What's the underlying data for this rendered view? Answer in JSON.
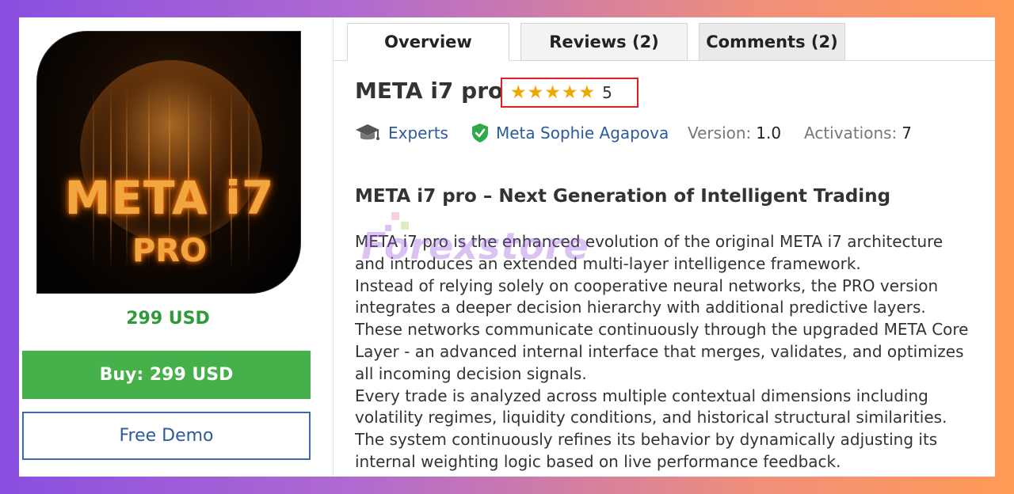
{
  "product": {
    "image_alt": "META i7 PRO logo",
    "logo_text_main": "META i7",
    "logo_text_sub": "PRO",
    "price": "299 USD",
    "buy_label": "Buy: 299 USD",
    "demo_label": "Free Demo",
    "title": "META i7 pro",
    "rating_stars": "★★★★★",
    "rating_value": "5",
    "category": "Experts",
    "author": "Meta Sophie Agapova",
    "version_label": "Version:",
    "version_value": "1.0",
    "activations_label": "Activations:",
    "activations_value": "7"
  },
  "tabs": {
    "overview": "Overview",
    "reviews": "Reviews (2)",
    "comments": "Comments (2)"
  },
  "description": {
    "heading": "META i7 pro – Next Generation of Intelligent Trading",
    "lines": [
      "META i7 pro is the enhanced evolution of the original META i7 architecture",
      "and introduces an extended multi-layer intelligence framework.",
      "Instead of relying solely on cooperative neural networks, the PRO version",
      "integrates a deeper decision hierarchy with additional predictive layers.",
      "These networks communicate continuously through the upgraded META Core",
      "Layer - an advanced internal interface that merges, validates, and optimizes",
      "all incoming decision signals.",
      "Every trade is analyzed across multiple contextual dimensions including",
      "volatility regimes, liquidity conditions, and historical structural similarities.",
      "The system continuously refines its behavior by dynamically adjusting its",
      "internal weighting logic based on live performance feedback."
    ]
  },
  "watermark": {
    "text": "Forexstore"
  },
  "colors": {
    "price_green": "#2e9a3a",
    "buy_green": "#46b04a",
    "link_blue": "#2d5b9a",
    "star_gold": "#f0a800",
    "rating_border": "#e02020"
  },
  "icons": {
    "category_icon": "graduation-cap-icon",
    "author_icon": "verified-shield-icon"
  }
}
